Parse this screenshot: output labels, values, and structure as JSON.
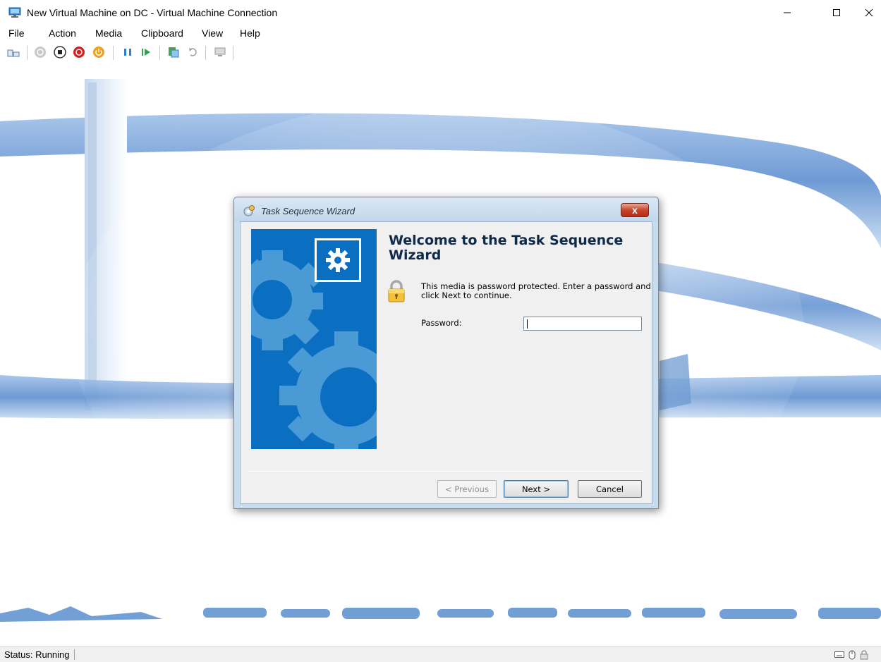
{
  "window": {
    "title": "New Virtual Machine on DC - Virtual Machine Connection",
    "minimize_glyph": "—",
    "maximize_glyph": "☐",
    "close_glyph": "✕"
  },
  "menu": [
    "File",
    "Action",
    "Media",
    "Clipboard",
    "View",
    "Help"
  ],
  "toolbar": {
    "buttons": [
      {
        "name": "ctrl-alt-del-icon"
      },
      {
        "name": "start-icon"
      },
      {
        "name": "turn-off-icon"
      },
      {
        "name": "shut-down-icon"
      },
      {
        "name": "power-icon"
      },
      {
        "name": "pause-icon"
      },
      {
        "name": "resume-icon"
      },
      {
        "name": "checkpoint-icon"
      },
      {
        "name": "revert-icon"
      },
      {
        "name": "enhanced-session-icon"
      }
    ]
  },
  "dialog": {
    "title": "Task Sequence Wizard",
    "close_glyph": "x",
    "heading": "Welcome to the Task Sequence Wizard",
    "message": "This media is password protected.  Enter a password and click Next to continue.",
    "password_label": "Password:",
    "password_value": "",
    "buttons": {
      "previous": "< Previous",
      "next": "Next >",
      "cancel": "Cancel"
    }
  },
  "status": {
    "text": "Status: Running"
  },
  "colors": {
    "banner": "#0b6fc1",
    "gear_light": "#4a9ad6",
    "heading": "#0f2a49"
  }
}
